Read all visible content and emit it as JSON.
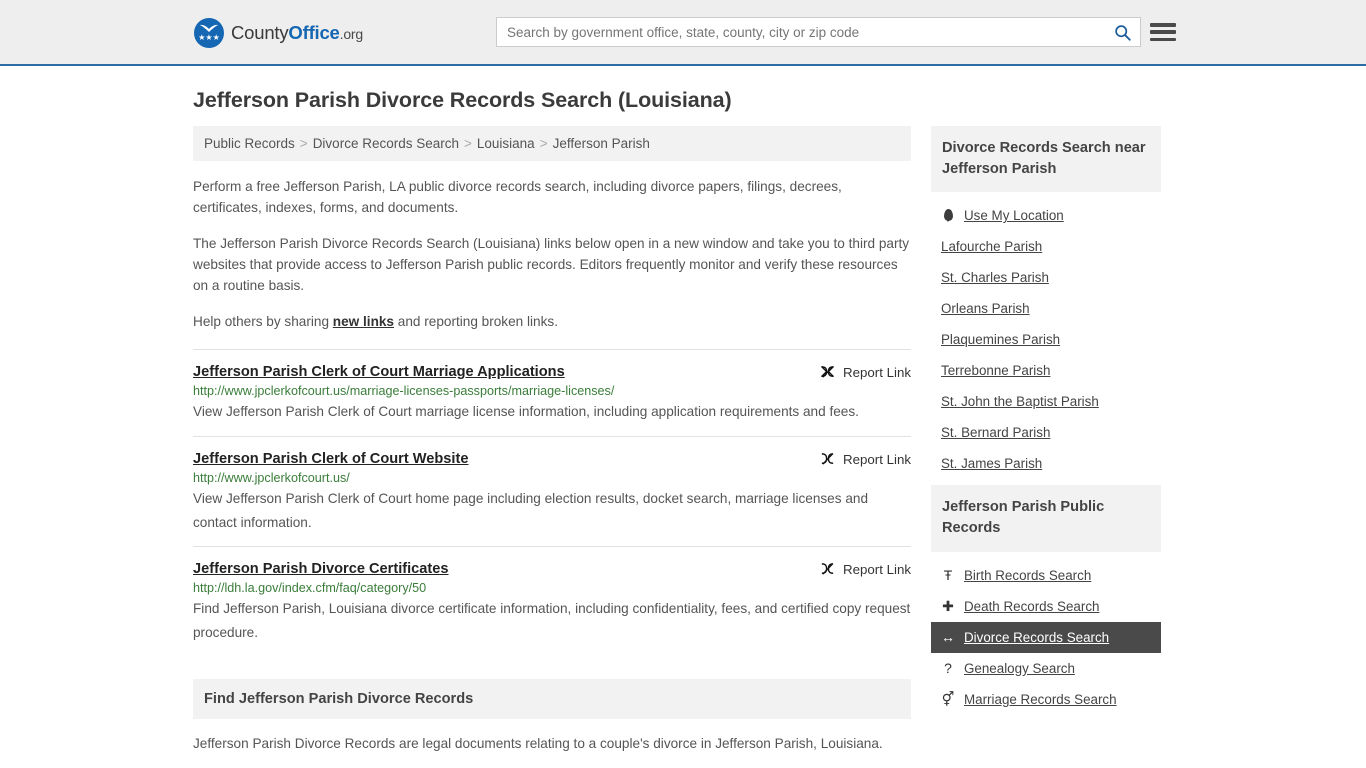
{
  "header": {
    "brand": {
      "part1": "County",
      "part2": "Office",
      "part3": ".org"
    },
    "search": {
      "placeholder": "Search by government office, state, county, city or zip code",
      "value": "",
      "button_icon": "search-icon"
    },
    "menu_icon": "hamburger-menu-icon",
    "accent_color": "#2e6da4"
  },
  "page_title": "Jefferson Parish Divorce Records Search (Louisiana)",
  "breadcrumb": {
    "separator": ">",
    "items": [
      {
        "label": "Public Records"
      },
      {
        "label": "Divorce Records Search"
      },
      {
        "label": "Louisiana"
      },
      {
        "label": "Jefferson Parish"
      }
    ]
  },
  "intro": {
    "p1": "Perform a free Jefferson Parish, LA public divorce records search, including divorce papers, filings, decrees, certificates, indexes, forms, and documents.",
    "p2": "The Jefferson Parish Divorce Records Search (Louisiana) links below open in a new window and take you to third party websites that provide access to Jefferson Parish public records. Editors frequently monitor and verify these resources on a routine basis.",
    "p3_before": "Help others by sharing ",
    "p3_link": "new links",
    "p3_after": " and reporting broken links."
  },
  "results": {
    "report_label": "Report Link",
    "report_icon": "broken-link-icon",
    "items": [
      {
        "title": "Jefferson Parish Clerk of Court Marriage Applications",
        "url": "http://www.jpclerkofcourt.us/marriage-licenses-passports/marriage-licenses/",
        "description": "View Jefferson Parish Clerk of Court marriage license information, including application requirements and fees."
      },
      {
        "title": "Jefferson Parish Clerk of Court Website",
        "url": "http://www.jpclerkofcourt.us/",
        "description": "View Jefferson Parish Clerk of Court home page including election results, docket search, marriage licenses and contact information."
      },
      {
        "title": "Jefferson Parish Divorce Certificates",
        "url": "http://ldh.la.gov/index.cfm/faq/category/50",
        "description": "Find Jefferson Parish, Louisiana divorce certificate information, including confidentiality, fees, and certified copy request procedure."
      }
    ]
  },
  "bottom_section": {
    "heading": "Find Jefferson Parish Divorce Records",
    "body": "Jefferson Parish Divorce Records are legal documents relating to a couple's divorce in Jefferson Parish, Louisiana."
  },
  "sidebar": {
    "nearby": {
      "heading": "Divorce Records Search near Jefferson Parish",
      "items": [
        {
          "label": "Use My Location",
          "icon": "map-pin-icon"
        },
        {
          "label": "Lafourche Parish",
          "icon": ""
        },
        {
          "label": "St. Charles Parish",
          "icon": ""
        },
        {
          "label": "Orleans Parish",
          "icon": ""
        },
        {
          "label": "Plaquemines Parish",
          "icon": ""
        },
        {
          "label": "Terrebonne Parish",
          "icon": ""
        },
        {
          "label": "St. John the Baptist Parish",
          "icon": ""
        },
        {
          "label": "St. Bernard Parish",
          "icon": ""
        },
        {
          "label": "St. James Parish",
          "icon": ""
        }
      ]
    },
    "public_records": {
      "heading": "Jefferson Parish Public Records",
      "active_index": 2,
      "active_color": "#4a4a4a",
      "items": [
        {
          "label": "Birth Records Search",
          "icon": "baby-icon",
          "glyph": "Ŧ"
        },
        {
          "label": "Death Records Search",
          "icon": "cross-icon",
          "glyph": "✚"
        },
        {
          "label": "Divorce Records Search",
          "icon": "left-right-arrow-icon",
          "glyph": "↔"
        },
        {
          "label": "Genealogy Search",
          "icon": "question-mark-icon",
          "glyph": "?"
        },
        {
          "label": "Marriage Records Search",
          "icon": "gender-symbols-icon",
          "glyph": "⚥"
        }
      ]
    }
  }
}
